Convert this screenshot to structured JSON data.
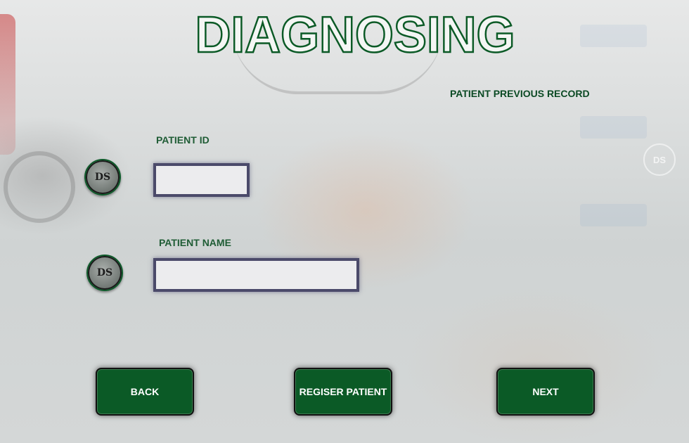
{
  "title": "DIAGNOSING",
  "links": {
    "previous_record": "PATIENT PREVIOUS RECORD"
  },
  "form": {
    "patient_id": {
      "label": "PATIENT ID",
      "value": "",
      "logo": "DS"
    },
    "patient_name": {
      "label": "PATIENT NAME",
      "value": "",
      "logo": "DS"
    }
  },
  "buttons": {
    "back": "BACK",
    "register": "REGISER PATIENT",
    "next": "NEXT"
  },
  "watermark": "DS",
  "colors": {
    "accent_green": "#0b5a26",
    "label_green": "#1f5c35",
    "field_border": "#4b4a6a"
  },
  "icons": {
    "logo": "ds-logo-icon"
  }
}
